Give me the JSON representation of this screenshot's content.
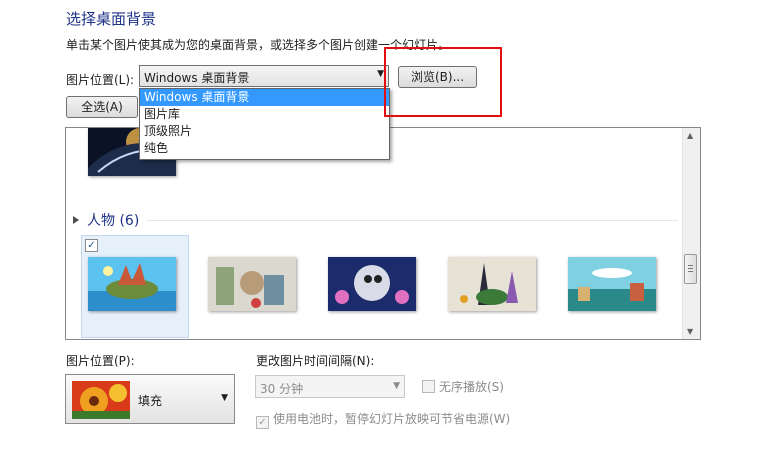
{
  "header": {
    "title": "选择桌面背景",
    "subtitle": "单击某个图片使其成为您的桌面背景，或选择多个图片创建一个幻灯片。"
  },
  "location": {
    "label": "图片位置(L):",
    "selected": "Windows 桌面背景",
    "options": [
      "Windows 桌面背景",
      "图片库",
      "顶级照片",
      "纯色"
    ]
  },
  "buttons": {
    "browse": "浏览(B)...",
    "select_all": "全选(A)"
  },
  "gallery": {
    "group_title": "人物 (6)",
    "thumbnails": [
      "people-1",
      "people-2",
      "people-3",
      "people-4",
      "people-5"
    ]
  },
  "position": {
    "label": "图片位置(P):",
    "value": "填充"
  },
  "interval": {
    "label": "更改图片时间间隔(N):",
    "value": "30 分钟"
  },
  "shuffle_label": "无序播放(S)",
  "battery_label": "使用电池时，暂停幻灯片放映可节省电源(W)",
  "icons": {
    "dropdown": "chevron-down-icon",
    "scroll_up": "scroll-up-icon",
    "scroll_down": "scroll-down-icon",
    "collapse": "collapse-triangle-icon"
  },
  "colors": {
    "title": "#1e3287",
    "highlight": "#3399ff",
    "annotation": "#e01010"
  }
}
